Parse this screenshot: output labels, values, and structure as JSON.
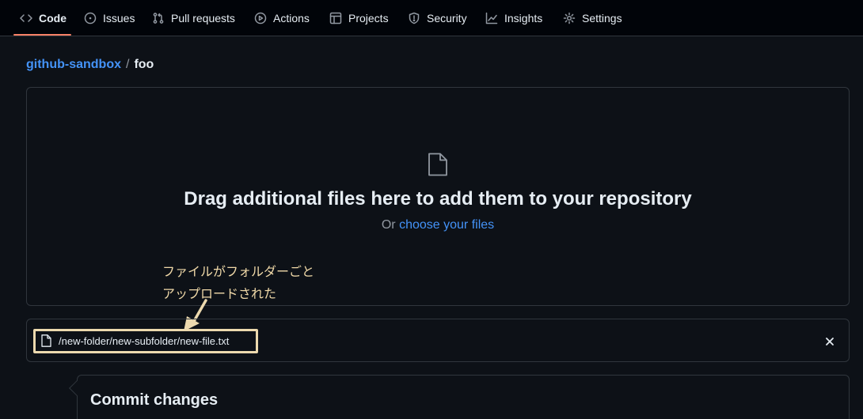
{
  "nav": {
    "tabs": [
      {
        "label": "Code",
        "icon": "code-icon",
        "active": true
      },
      {
        "label": "Issues",
        "icon": "issue-icon"
      },
      {
        "label": "Pull requests",
        "icon": "pull-request-icon"
      },
      {
        "label": "Actions",
        "icon": "play-icon"
      },
      {
        "label": "Projects",
        "icon": "table-icon"
      },
      {
        "label": "Security",
        "icon": "shield-icon"
      },
      {
        "label": "Insights",
        "icon": "graph-icon"
      },
      {
        "label": "Settings",
        "icon": "gear-icon"
      }
    ]
  },
  "breadcrumb": {
    "repo": "github-sandbox",
    "separator": "/",
    "current": "foo"
  },
  "dropzone": {
    "title": "Drag additional files here to add them to your repository",
    "or_text": "Or",
    "link_text": "choose your files"
  },
  "annotation": {
    "line1": "ファイルがフォルダーごと",
    "line2": "アップロードされた"
  },
  "file": {
    "path": "/new-folder/new-subfolder/new-file.txt"
  },
  "commit": {
    "title": "Commit changes"
  },
  "colors": {
    "accent_link": "#4493f8",
    "active_tab_underline": "#f78166",
    "annotation": "#f0d9a8"
  }
}
